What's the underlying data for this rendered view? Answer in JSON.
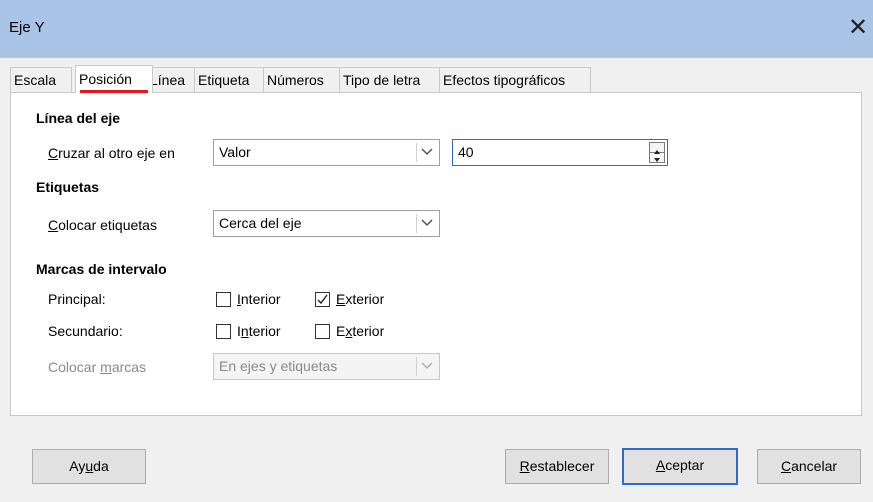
{
  "window": {
    "title": "Eje Y",
    "close_glyph": "✕"
  },
  "tabs": [
    {
      "label": "Escala"
    },
    {
      "label": "Posición"
    },
    {
      "label": "Línea"
    },
    {
      "label": "Etiqueta"
    },
    {
      "label": "Números"
    },
    {
      "label": "Tipo de letra"
    },
    {
      "label": "Efectos tipográficos"
    }
  ],
  "active_tab": "Posición",
  "axis_line": {
    "heading": "Línea del eje",
    "cross_label_u": "C",
    "cross_label_rest": "ruzar al otro eje en",
    "cross_select": "Valor",
    "cross_value": "40"
  },
  "labels": {
    "heading": "Etiquetas",
    "place_label_u": "C",
    "place_label_rest": "olocar etiquetas",
    "place_select": "Cerca del eje"
  },
  "ticks": {
    "heading": "Marcas de intervalo",
    "major_label": "Principal:",
    "minor_label": "Secundario:",
    "inner_u": "I",
    "inner_rest": "nterior",
    "outer_u": "E",
    "outer_rest": "xterior",
    "minor_inner_pre": "I",
    "minor_inner_u": "n",
    "minor_inner_rest": "terior",
    "minor_outer_pre": "E",
    "minor_outer_u": "x",
    "minor_outer_rest": "terior",
    "major_inner_checked": false,
    "major_outer_checked": true,
    "minor_inner_checked": false,
    "minor_outer_checked": false,
    "place_marks_pre": "Colocar ",
    "place_marks_u": "m",
    "place_marks_rest": "arcas",
    "place_marks_select": "En ejes y etiquetas"
  },
  "buttons": {
    "help_pre": "Ay",
    "help_u": "u",
    "help_rest": "da",
    "reset_u": "R",
    "reset_rest": "establecer",
    "ok_u": "A",
    "ok_rest": "ceptar",
    "cancel_u": "C",
    "cancel_rest": "ancelar"
  },
  "colors": {
    "titlebar": "#a9c4e6",
    "focus": "#2d6bd0",
    "active_tab_marker": "#e0181e"
  }
}
